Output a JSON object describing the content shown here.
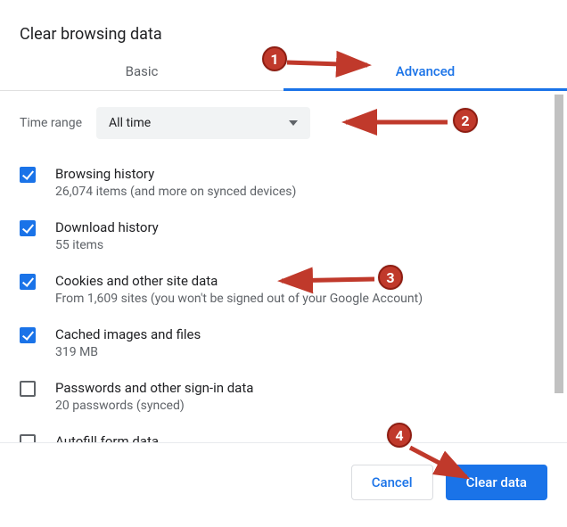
{
  "dialog": {
    "title": "Clear browsing data",
    "tabs": {
      "basic": "Basic",
      "advanced": "Advanced"
    },
    "time_range": {
      "label": "Time range",
      "value": "All time"
    },
    "options": [
      {
        "checked": true,
        "label": "Browsing history",
        "desc": "26,074 items (and more on synced devices)"
      },
      {
        "checked": true,
        "label": "Download history",
        "desc": "55 items"
      },
      {
        "checked": true,
        "label": "Cookies and other site data",
        "desc": "From 1,609 sites (you won't be signed out of your Google Account)"
      },
      {
        "checked": true,
        "label": "Cached images and files",
        "desc": "319 MB"
      },
      {
        "checked": false,
        "label": "Passwords and other sign-in data",
        "desc": "20 passwords (synced)"
      },
      {
        "checked": false,
        "label": "Autofill form data",
        "desc": ""
      }
    ],
    "footer": {
      "cancel": "Cancel",
      "clear": "Clear data"
    }
  },
  "annotations": {
    "step1": "1",
    "step2": "2",
    "step3": "3",
    "step4": "4",
    "color": "#c0392b"
  }
}
